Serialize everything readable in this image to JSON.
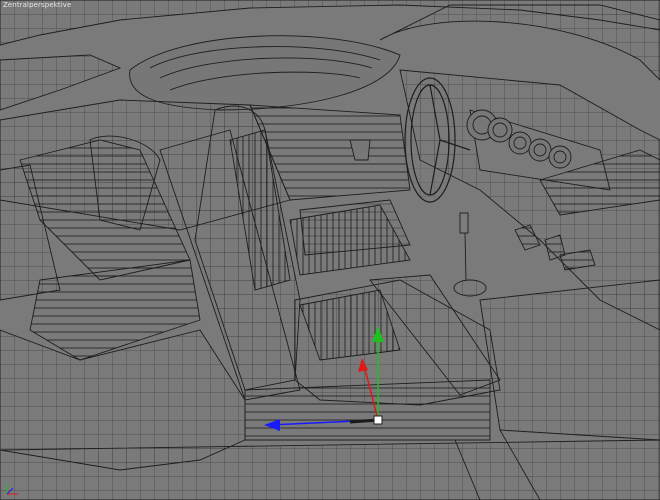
{
  "viewport": {
    "label": "Zentralperspektive",
    "background": "#7a7a7a",
    "wire_color": "#1e1e1e",
    "fill_color": "#7c7c7c"
  },
  "gizmo": {
    "x_axis_color": "#1a1aff",
    "y_axis_color": "#20c020",
    "z_axis_color": "#e01818",
    "pivot_icon": "move-gizmo-icon"
  },
  "corner_axes": {
    "x_color": "#e01818",
    "y_color": "#20c020",
    "z_color": "#1a1aff"
  }
}
